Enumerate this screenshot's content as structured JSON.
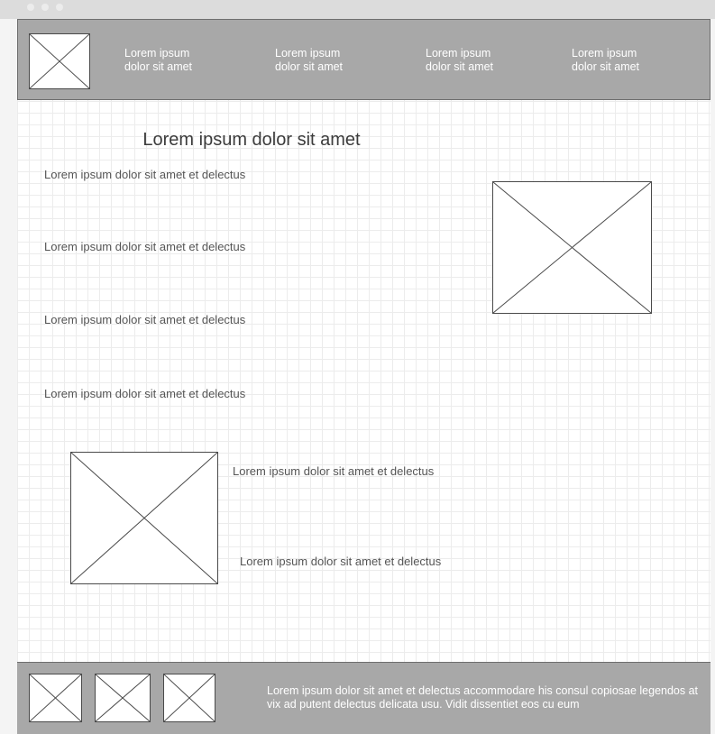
{
  "window": {
    "controls": [
      "close-dot",
      "minimize-dot",
      "zoom-dot"
    ]
  },
  "header": {
    "logo_icon": "image-placeholder-icon",
    "nav": [
      {
        "label": "Lorem ipsum\ndolor sit amet"
      },
      {
        "label": "Lorem ipsum\ndolor sit amet"
      },
      {
        "label": "Lorem ipsum\ndolor sit amet"
      },
      {
        "label": "Lorem ipsum\ndolor sit amet"
      }
    ]
  },
  "main": {
    "title": "Lorem ipsum dolor sit amet",
    "left_paragraphs": [
      "Lorem ipsum dolor sit amet et delectus",
      "Lorem ipsum dolor sit amet et delectus",
      "Lorem ipsum dolor sit amet et delectus",
      "Lorem ipsum dolor sit amet et delectus"
    ],
    "lower_paragraphs": [
      "Lorem ipsum dolor sit amet et delectus",
      "Lorem ipsum dolor sit amet et delectus"
    ]
  },
  "footer": {
    "text": "Lorem ipsum dolor sit amet et delectus accommodare his consul copiosae legendos at vix ad putent delectus delicata usu. Vidit dissentiet eos cu eum"
  },
  "colors": {
    "bar_gray": "#a8a8a8",
    "grid_line": "#ececec",
    "placeholder_stroke": "#4a4a4a"
  }
}
